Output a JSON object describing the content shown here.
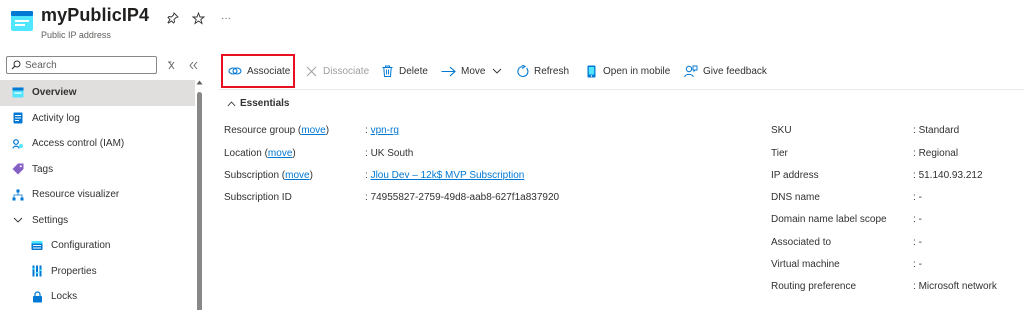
{
  "header": {
    "title": "myPublicIP4",
    "subtitle": "Public IP address",
    "more": "···"
  },
  "sidebar": {
    "search_placeholder": "Search",
    "items": [
      {
        "label": "Overview",
        "icon": "overview-icon"
      },
      {
        "label": "Activity log",
        "icon": "activity-log-icon"
      },
      {
        "label": "Access control (IAM)",
        "icon": "iam-icon"
      },
      {
        "label": "Tags",
        "icon": "tag-icon"
      },
      {
        "label": "Resource visualizer",
        "icon": "visualizer-icon"
      },
      {
        "label": "Settings",
        "icon": "chevron-down-icon"
      },
      {
        "label": "Configuration",
        "icon": "configuration-icon"
      },
      {
        "label": "Properties",
        "icon": "properties-icon"
      },
      {
        "label": "Locks",
        "icon": "lock-icon"
      }
    ]
  },
  "toolbar": {
    "associate": "Associate",
    "dissociate": "Dissociate",
    "delete": "Delete",
    "move": "Move",
    "refresh": "Refresh",
    "open_mobile": "Open in mobile",
    "feedback": "Give feedback"
  },
  "essentials": {
    "title": "Essentials",
    "left": [
      {
        "label": "Resource group",
        "link": "move",
        "value": "vpn-rg",
        "value_is_link": true
      },
      {
        "label": "Location",
        "link": "move",
        "value": "UK South",
        "value_is_link": false
      },
      {
        "label": "Subscription",
        "link": "move",
        "value": "Jlou Dev – 12k$ MVP Subscription",
        "value_is_link": true
      },
      {
        "label": "Subscription ID",
        "link": "",
        "value": "74955827-2759-49d8-aab8-627f1a837920",
        "value_is_link": false
      }
    ],
    "right": [
      {
        "label": "SKU",
        "value": "Standard"
      },
      {
        "label": "Tier",
        "value": "Regional"
      },
      {
        "label": "IP address",
        "value": "51.140.93.212"
      },
      {
        "label": "DNS name",
        "value": "-"
      },
      {
        "label": "Domain name label scope",
        "value": "-"
      },
      {
        "label": "Associated to",
        "value": "-"
      },
      {
        "label": "Virtual machine",
        "value": "-"
      },
      {
        "label": "Routing preference",
        "value": "Microsoft network"
      }
    ]
  },
  "colors": {
    "accent": "#0078d4",
    "highlight": "#e81123",
    "active_nav": "#e1dfdd"
  }
}
